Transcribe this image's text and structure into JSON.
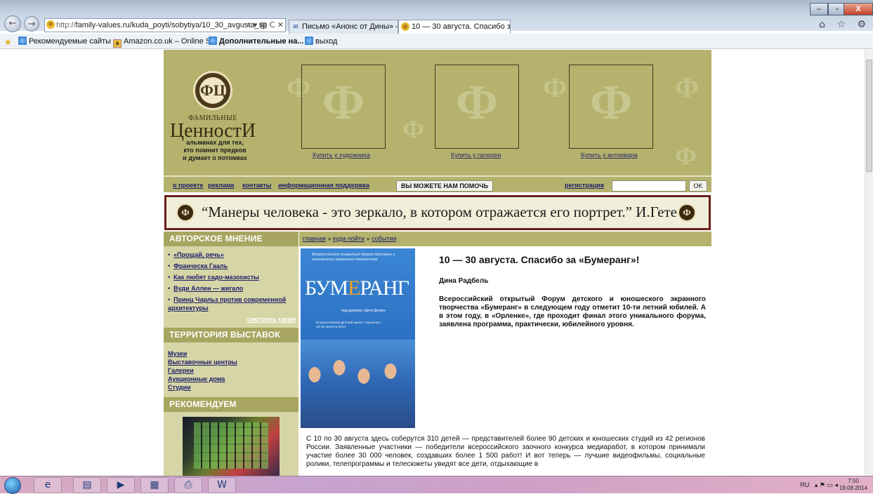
{
  "browser": {
    "url_protocol": "http://",
    "url_rest": "family-values.ru/kuda_poyti/sobytiya/10_30_avgusta_sp",
    "url_controls": "⌕ ▾ ▤ C ✕",
    "tabs": [
      {
        "label": "Письмо «Анонс от Дины» — ...",
        "close": ""
      },
      {
        "label": "10 — 30 августа. Спасибо з...",
        "close": "✕"
      }
    ],
    "window_controls": {
      "minimize": "–",
      "maximize": "▫",
      "close": "X"
    },
    "right_icons": "⌂ ☆ ⚙"
  },
  "favorites": {
    "items": [
      {
        "label": "Рекомендуемые сайты ▾"
      },
      {
        "label": "Amazon.co.uk – Online S..."
      },
      {
        "label": "Дополнительные на... ▾"
      },
      {
        "label": "выход"
      }
    ]
  },
  "site": {
    "logo": {
      "emblem": "ФЦ",
      "small": "ФАМИЛЬНЫЕ",
      "big": "ЦенностИ",
      "tagline": [
        "альманах для тех,",
        "кто помнит предков",
        "и думает о потомках"
      ]
    },
    "shops": [
      {
        "label": "Купить у художника"
      },
      {
        "label": "Купить у галереи"
      },
      {
        "label": "Купить у антиквара"
      }
    ],
    "nav": {
      "links": [
        "о проекте",
        "реклама",
        "контакты",
        "информационная поддержка"
      ],
      "help_button": "ВЫ МОЖЕТЕ НАМ ПОМОЧЬ",
      "register": "регистрация",
      "ok": "OK"
    },
    "quote": "“Манеры человека - это зеркало, в котором отражается его портрет.” И.Гете",
    "sidebar": {
      "opinion_title": "АВТОРСКОЕ МНЕНИЕ",
      "opinion_items": [
        "«Прощай, речь»",
        "Франческа Гааль",
        "Как любят садо-мазохисты",
        "Вуди Аллен — жигало",
        "Принц Чарльз против современной архитектуры"
      ],
      "see_also": "смотреть также",
      "territory_title": "ТЕРРИТОРИЯ ВЫСТАВОК",
      "territory_items": [
        "Музеи",
        "Выставочные центры",
        "Галереи",
        "Аукционные дома",
        "Студии"
      ],
      "recommend_title": "РЕКОМЕНДУЕМ"
    },
    "breadcrumb": {
      "items": [
        "главная",
        "куда пойти",
        "события"
      ],
      "sep": " » "
    },
    "article": {
      "poster": {
        "header": "Всероссийский открытый форум детского и юношеского экранного творчества",
        "title_a": "БУМ",
        "title_b": "Е",
        "title_c": "РАНГ",
        "subtitle": "под девизом «Дети-Детям»",
        "info": "Всероссийский детский центр «Орлёнок» 10-30 августа 2014"
      },
      "title": "10 — 30 августа. Спасибо за «Бумеранг»!",
      "author": "Дина Радбель",
      "lead": "Всероссийский открытый Форум детского и юношеского экранного творчества «Бумеранг» в следующем году отметит 10-ти летний юбилей. А в этом году, в «Орленке», где проходит финал этого уникального форума, заявлена программа, практически, юбилейного уровня.",
      "body": "С 10 по 30 августа здесь соберутся 310 детей — представителей более 90 детских и юношеских студий из 42 регионов России. Заявленные участники — победители всероссийского заочного конкурса медиаработ, в котором принимали участие более 30 000 человек, создавших более 1 500 работ! И вот теперь — лучшие видеофильмы, социальные ролики, телепрограммы и телесюжеты увидят все дети, отдыхающие в"
    }
  },
  "taskbar": {
    "lang": "RU",
    "tray_icons": "▴ ⚑ ▭ ◂",
    "time": "7:50",
    "date": "19.08.2014"
  },
  "colors": {
    "header_olive": "#b5b26d",
    "sidebar": "#d6d5a6",
    "quote_border": "#6b1e1a"
  }
}
